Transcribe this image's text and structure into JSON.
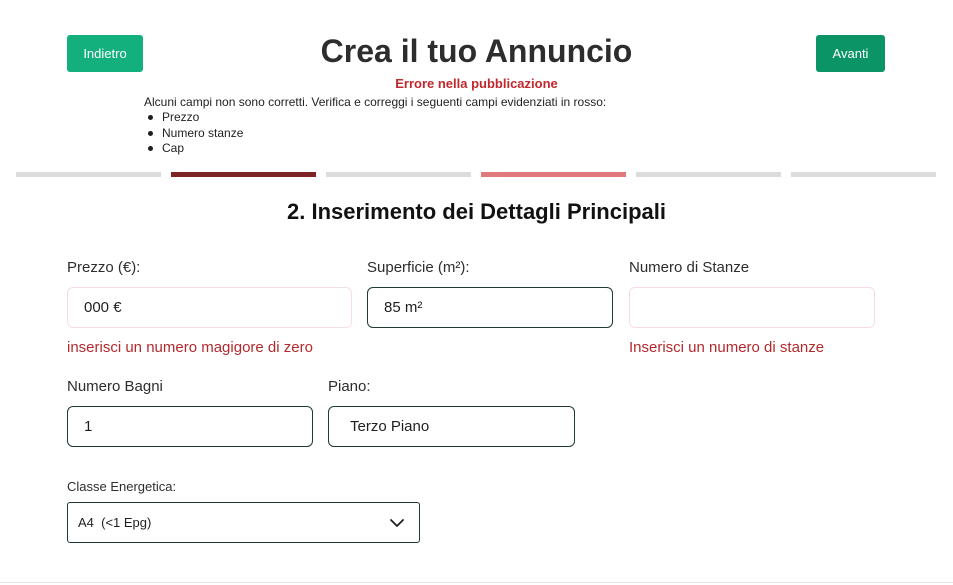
{
  "header": {
    "back_label": "Indietro",
    "title": "Crea il tuo Annuncio",
    "next_label": "Avanti"
  },
  "error": {
    "title": "Errore nella pubblicazione",
    "description": "Alcuni campi non sono corretti. Verifica e correggi i seguenti campi evidenziati in rosso:",
    "fields": [
      "Prezzo",
      "Numero stanze",
      "Cap"
    ]
  },
  "progress": {
    "total_steps": 6,
    "current_step": 2,
    "error_step": 4,
    "colors": {
      "inactive": "#dcdcdc",
      "active": "#7d2326",
      "error": "#e07a7d"
    }
  },
  "section": {
    "title": "2. Inserimento dei Dettagli Principali"
  },
  "form": {
    "prezzo": {
      "label": "Prezzo (€):",
      "value": "000 €",
      "error": "inserisci un numero magigore di zero"
    },
    "superficie": {
      "label": "Superficie (m²):",
      "value": "85 m²"
    },
    "stanze": {
      "label": "Numero di Stanze",
      "value": "",
      "error": "Inserisci un numero di stanze"
    },
    "bagni": {
      "label": "Numero Bagni",
      "value": "1"
    },
    "piano": {
      "label": "Piano:",
      "value": "Terzo Piano"
    },
    "classe": {
      "label": "Classe Energetica:",
      "value": "A4  (<1 Epg)",
      "icon": "chevron-down-icon"
    }
  },
  "colors": {
    "primary_green": "#13b07e",
    "dark_green": "#0b9466",
    "error_red": "#c0282d"
  }
}
